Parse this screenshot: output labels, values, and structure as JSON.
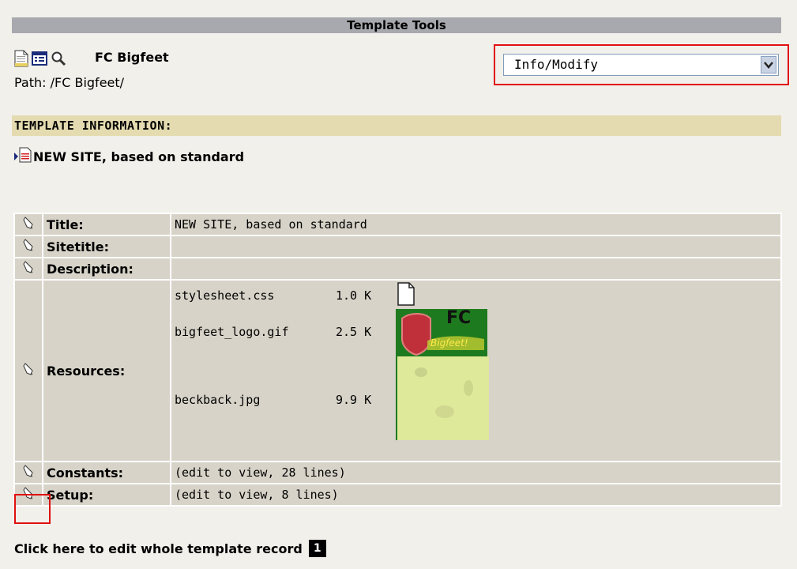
{
  "header": {
    "title": "Template Tools"
  },
  "site": {
    "title": "FC Bigfeet",
    "path": "Path: /FC Bigfeet/"
  },
  "menu": {
    "selected": "Info/Modify"
  },
  "section": {
    "title": "TEMPLATE INFORMATION:"
  },
  "template": {
    "name": "NEW SITE, based on standard"
  },
  "table": {
    "title_label": "Title:",
    "title_value": "NEW SITE, based on standard",
    "sitetitle_label": "Sitetitle:",
    "description_label": "Description:",
    "resources_label": "Resources:",
    "resources": [
      {
        "file": "stylesheet.css",
        "size": "1.0 K"
      },
      {
        "file": "bigfeet_logo.gif",
        "size": "2.5 K"
      },
      {
        "file": "beckback.jpg",
        "size": "9.9 K"
      }
    ],
    "constants_label": "Constants:",
    "constants_value": "(edit to view, 28 lines)",
    "setup_label": "Setup:",
    "setup_value": "(edit to view, 8 lines)"
  },
  "logo_text": {
    "fc": "FC",
    "sub": "Bigfeet!"
  },
  "footer": {
    "text": "Click here to edit whole template record",
    "badge": "1"
  },
  "colors": {
    "header_bg": "#a8a9ae",
    "section_bg": "#e4dbb0",
    "table_bg": "#d7d3c8",
    "highlight": "#e01010",
    "logo_green": "#1e7a1e"
  }
}
